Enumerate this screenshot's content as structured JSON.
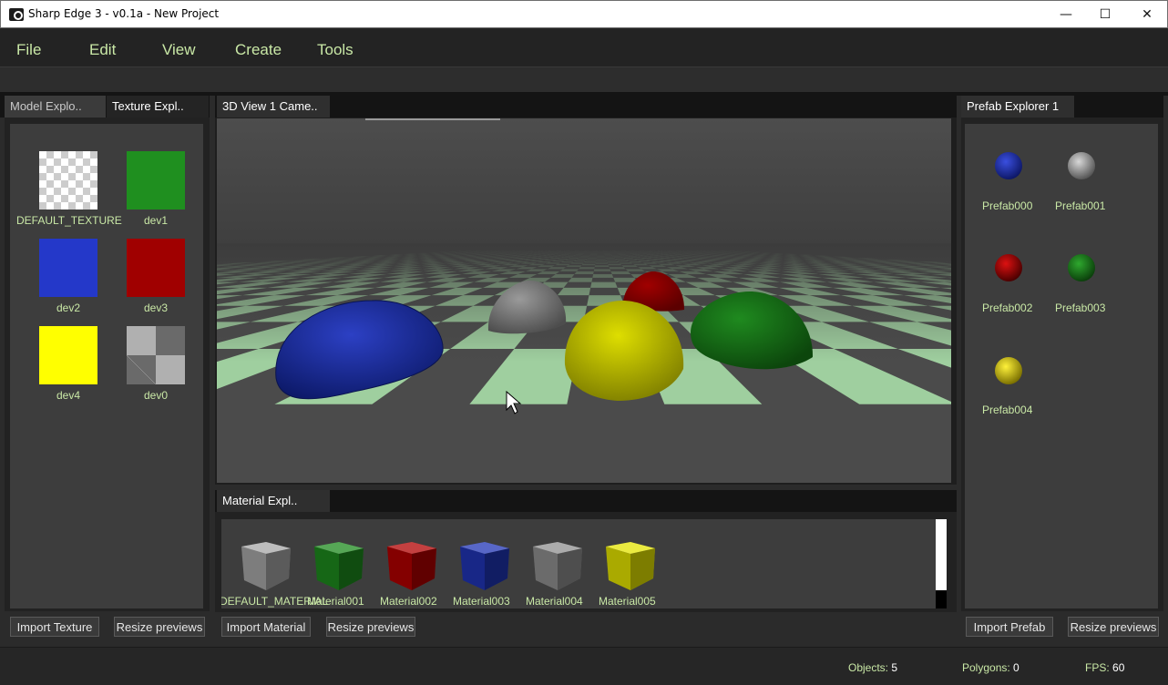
{
  "window": {
    "title": "Sharp Edge 3 - v0.1a - New Project",
    "minimize": "—",
    "maximize": "☐",
    "close": "✕"
  },
  "menu": [
    "File",
    "Edit",
    "View",
    "Create",
    "Tools"
  ],
  "left_tabs": [
    "Model Explo..",
    "Texture Expl.."
  ],
  "center_tab": "3D View 1 Came..",
  "material_tab": "Material Expl..",
  "right_tab": "Prefab Explorer 1",
  "textures": [
    {
      "name": "DEFAULT_TEXTURE",
      "color": "#ffffff"
    },
    {
      "name": "dev1",
      "color": "#1f8f1f"
    },
    {
      "name": "dev2",
      "color": "#2438c9"
    },
    {
      "name": "dev3",
      "color": "#a00000"
    },
    {
      "name": "dev4",
      "color": "#ffff00"
    },
    {
      "name": "dev0",
      "color": "#9a9a9a"
    }
  ],
  "materials": [
    {
      "name": "DEFAULT_MATERIAL",
      "color": "#a7a7a7"
    },
    {
      "name": "Material001",
      "color": "#1e8a1e"
    },
    {
      "name": "Material002",
      "color": "#b00000"
    },
    {
      "name": "Material003",
      "color": "#2035b5"
    },
    {
      "name": "Material004",
      "color": "#8f8f8f"
    },
    {
      "name": "Material005",
      "color": "#e3e300"
    }
  ],
  "prefabs": [
    {
      "name": "Prefab000",
      "color": "#1f2fb0"
    },
    {
      "name": "Prefab001",
      "color": "#a0a0a0"
    },
    {
      "name": "Prefab002",
      "color": "#b00000"
    },
    {
      "name": "Prefab003",
      "color": "#1e7d1e"
    },
    {
      "name": "Prefab004",
      "color": "#d9d000"
    }
  ],
  "buttons": {
    "import_texture": "Import Texture",
    "resize_previews": "Resize previews",
    "import_material": "Import Material",
    "import_prefab": "Import Prefab"
  },
  "status": {
    "objects_label": "Objects:",
    "objects_value": "5",
    "polygons_label": "Polygons:",
    "polygons_value": "0",
    "fps_label": "FPS:",
    "fps_value": "60"
  },
  "colors": {
    "accent_text": "#c9e8a6",
    "floor_light": "#9fcf9f",
    "floor_dark": "#4b4b4b"
  }
}
